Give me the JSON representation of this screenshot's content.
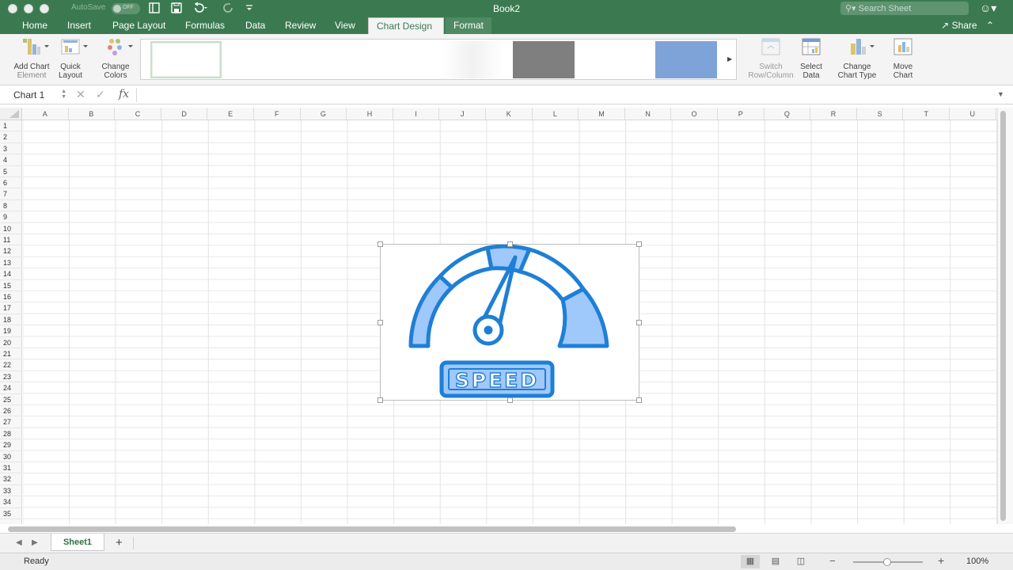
{
  "window": {
    "autosave_label": "AutoSave",
    "autosave_state": "OFF",
    "title": "Book2",
    "search_placeholder": "Search Sheet"
  },
  "ribbon_tabs": [
    {
      "label": "Home"
    },
    {
      "label": "Insert"
    },
    {
      "label": "Page Layout"
    },
    {
      "label": "Formulas"
    },
    {
      "label": "Data"
    },
    {
      "label": "Review"
    },
    {
      "label": "View"
    },
    {
      "label": "Chart Design"
    },
    {
      "label": "Format"
    }
  ],
  "active_tab": "Chart Design",
  "share_label": "Share",
  "ribbon": {
    "add_chart_element": {
      "line1": "Add Chart",
      "line2": "Element"
    },
    "quick_layout": {
      "line1": "Quick",
      "line2": "Layout"
    },
    "change_colors": {
      "line1": "Change",
      "line2": "Colors"
    },
    "switch_row_column": {
      "line1": "Switch",
      "line2": "Row/Column"
    },
    "select_data": {
      "line1": "Select",
      "line2": "Data"
    },
    "change_chart_type": {
      "line1": "Change",
      "line2": "Chart Type"
    },
    "move_chart": {
      "line1": "Move",
      "line2": "Chart"
    }
  },
  "chart_styles": [
    {
      "color": "#ffffff",
      "selected": true
    },
    {
      "color": "#ffffff"
    },
    {
      "color": "#ffffff"
    },
    {
      "color": "#f6f6f6"
    },
    {
      "color": "#7f7f7f"
    },
    {
      "color": "#ffffff"
    },
    {
      "color": "#7ea3d8"
    }
  ],
  "formula_bar": {
    "name_box": "Chart 1",
    "fx_label": "fx",
    "formula": ""
  },
  "columns": [
    "A",
    "B",
    "C",
    "D",
    "E",
    "F",
    "G",
    "H",
    "I",
    "J",
    "K",
    "L",
    "M",
    "N",
    "O",
    "P",
    "Q",
    "R",
    "S",
    "T",
    "U"
  ],
  "rows": [
    "1",
    "2",
    "3",
    "4",
    "5",
    "6",
    "7",
    "8",
    "9",
    "10",
    "11",
    "12",
    "13",
    "14",
    "15",
    "16",
    "17",
    "18",
    "19",
    "20",
    "21",
    "22",
    "23",
    "24",
    "25",
    "26",
    "27",
    "28",
    "29",
    "30",
    "31",
    "32",
    "33",
    "34",
    "35"
  ],
  "chart": {
    "label": "SPEED",
    "colors": {
      "stroke": "#1e7fd6",
      "fill": "#9fc8fb"
    }
  },
  "sheets": [
    {
      "name": "Sheet1",
      "active": true
    }
  ],
  "status": {
    "text": "Ready",
    "zoom": "100%"
  }
}
